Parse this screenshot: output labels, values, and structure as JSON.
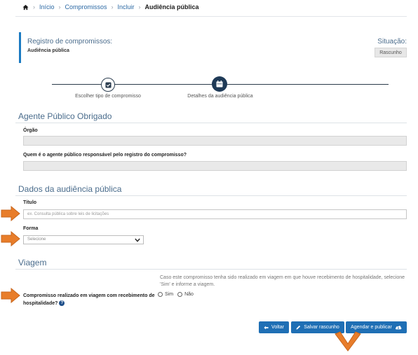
{
  "breadcrumb": {
    "items": [
      "Início",
      "Compromissos",
      "Incluir"
    ],
    "current": "Audiência pública"
  },
  "header": {
    "title": "Registro de compromissos:",
    "subtitle": "Audiência pública",
    "situation_label": "Situação:",
    "situation_value": "Rascunho"
  },
  "stepper": {
    "steps": [
      {
        "label": "Escolher tipo de compromisso",
        "icon": "check-icon"
      },
      {
        "label": "Detalhes da audiência pública",
        "icon": "calendar-icon"
      }
    ]
  },
  "section_agente": {
    "title": "Agente Público Obrigado",
    "orgao_label": "Órgão",
    "agente_label": "Quem é o agente público responsável pelo registro do compromisso?"
  },
  "section_dados": {
    "title": "Dados da audiência pública",
    "titulo_label": "Título",
    "titulo_placeholder": "ex. Consulta pública sobre leis de licitações",
    "forma_label": "Forma",
    "forma_selected": "Selecione"
  },
  "section_viagem": {
    "title": "Viagem",
    "hint": "Caso este compromisso tenha sido realizado em viagem em que houve recebimento de hospitalidade, selecione 'Sim' e informe a viagem.",
    "question": "Compromisso realizado em viagem com recebimento de hospitalidade?",
    "help_icon": "?",
    "options": [
      "Sim",
      "Não"
    ]
  },
  "buttons": {
    "voltar": "Voltar",
    "salvar": "Salvar rascunho",
    "agendar": "Agendar e publicar"
  },
  "colors": {
    "primary_button": "#1f6fb5",
    "accent_border": "#1c7bc2",
    "annotation_arrow": "#e87d2a",
    "step_active": "#1f3a57"
  }
}
